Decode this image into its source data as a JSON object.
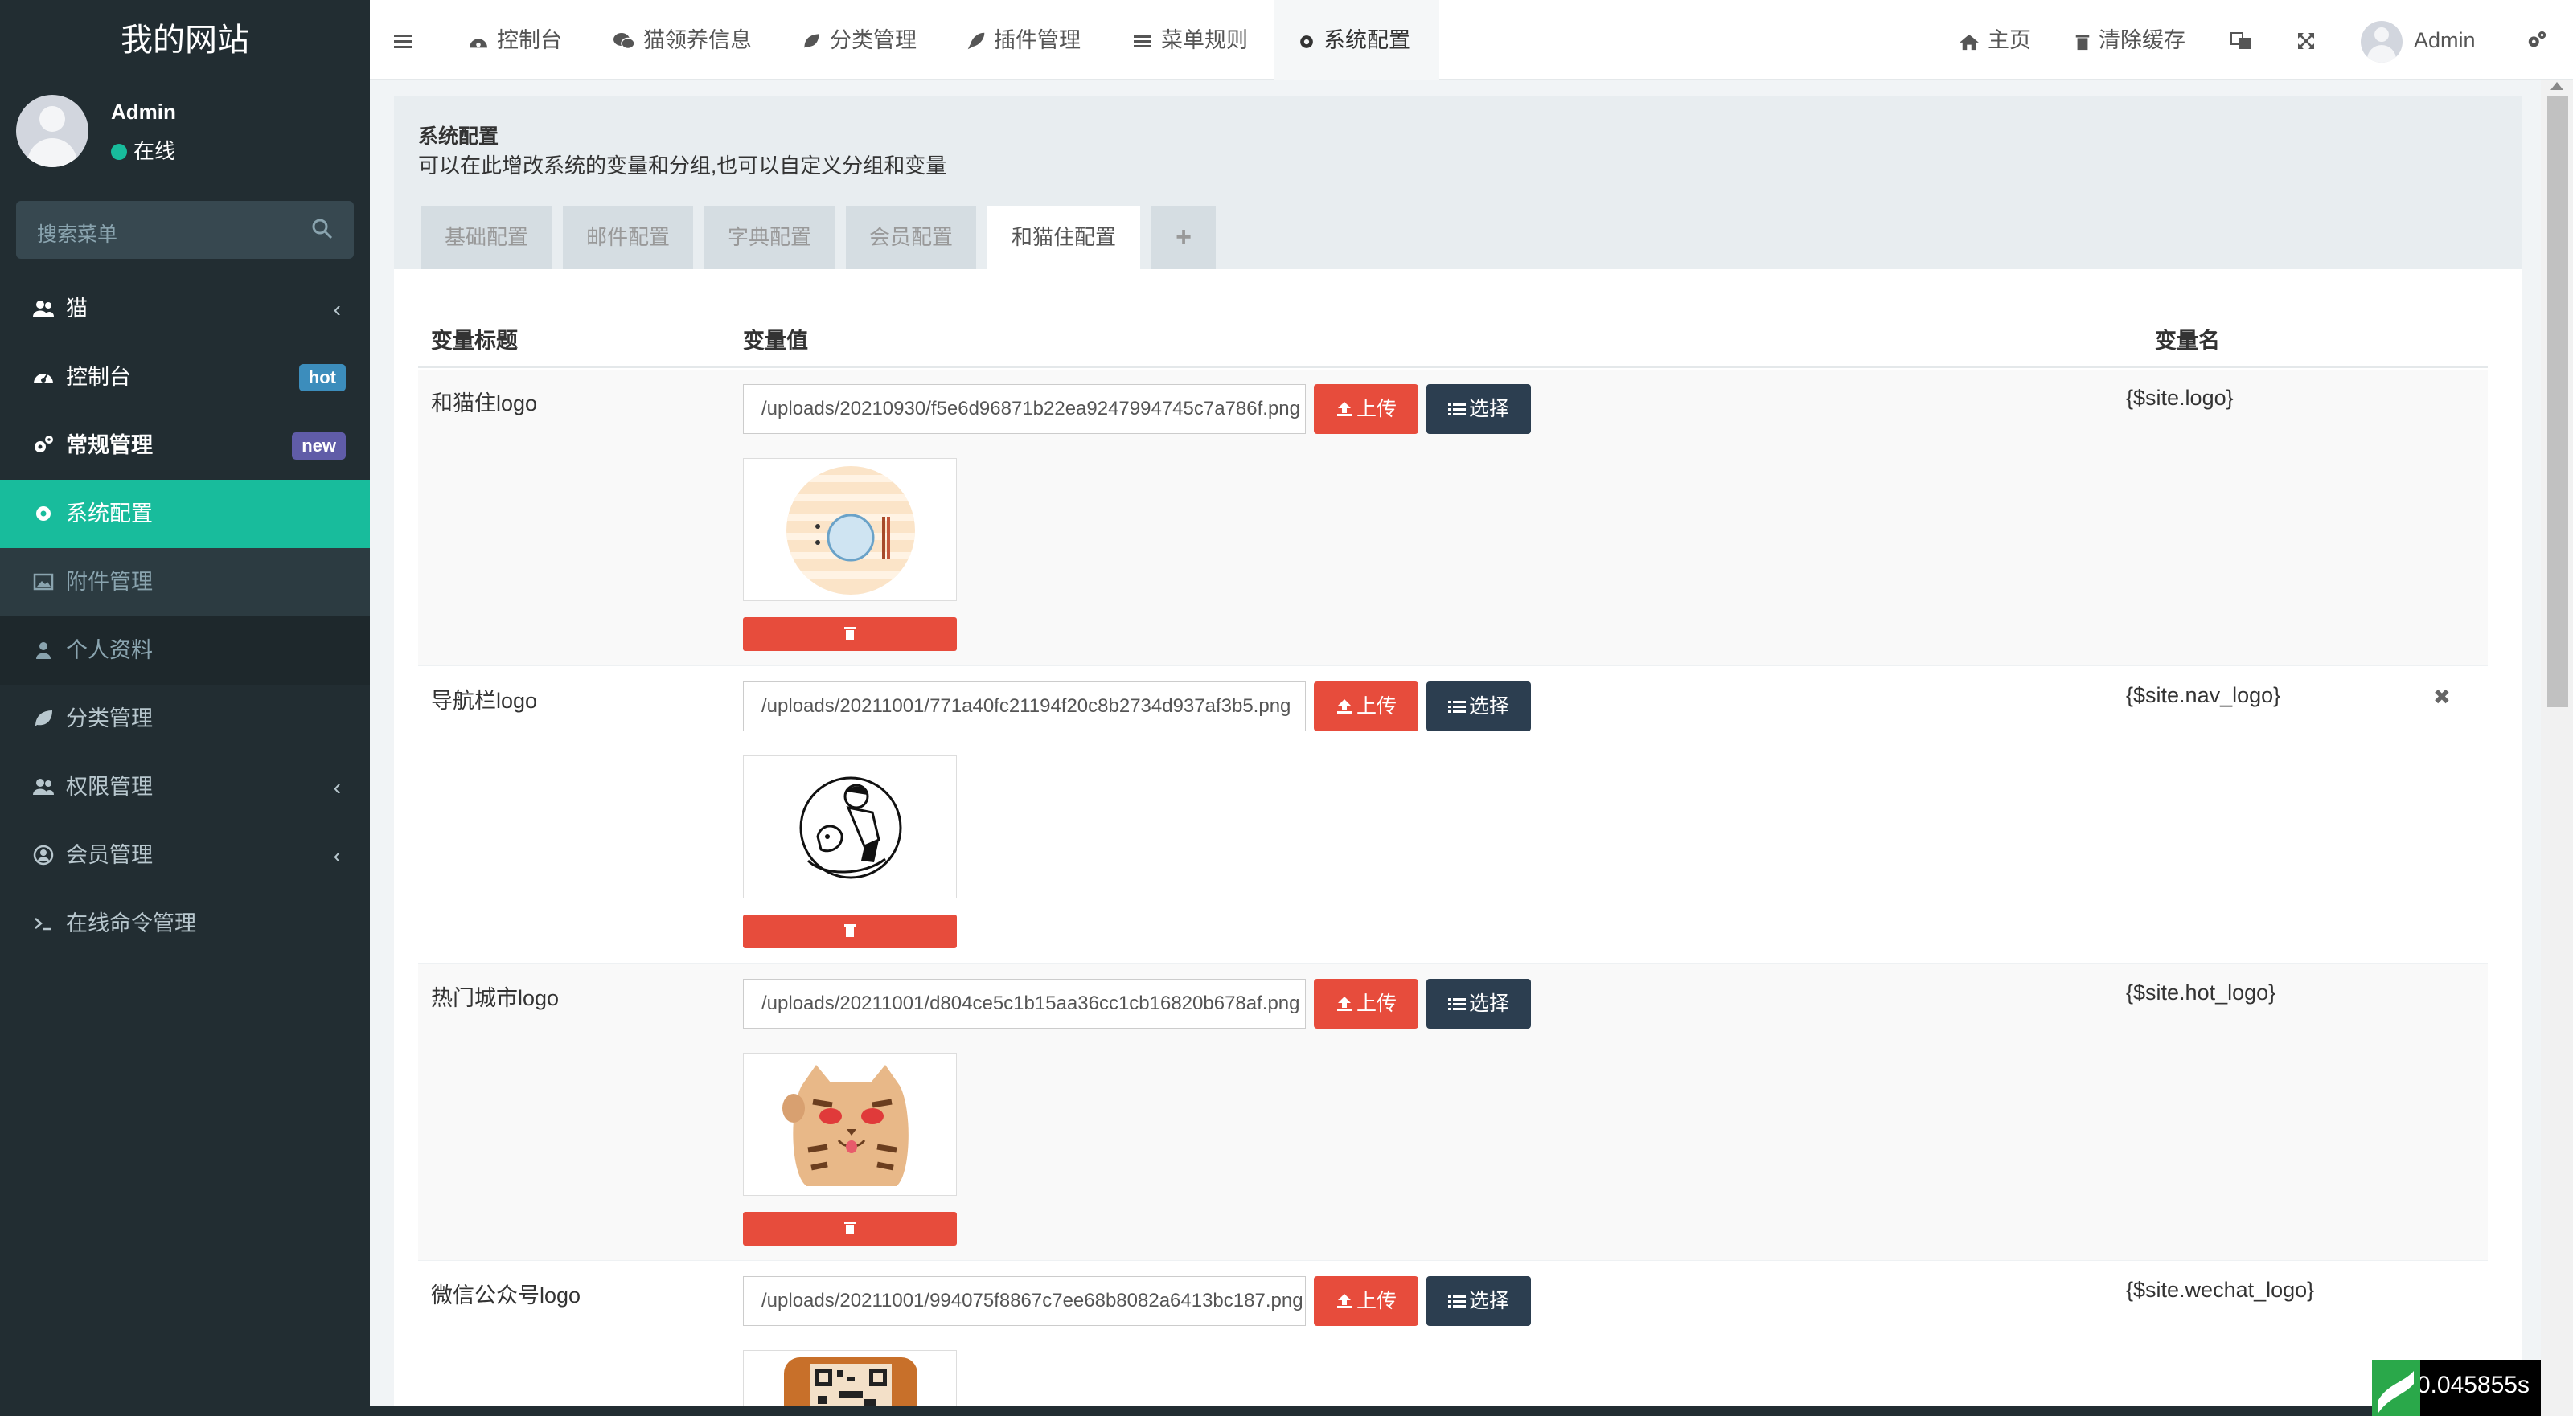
{
  "brand": "我的网站",
  "user": {
    "name": "Admin",
    "status": "在线"
  },
  "sidebar": {
    "search_placeholder": "搜索菜单",
    "items": [
      {
        "label": "猫",
        "icon": "users-icon"
      },
      {
        "label": "控制台",
        "icon": "dashboard-icon",
        "badge": "hot"
      },
      {
        "label": "常规管理",
        "icon": "cogs-icon",
        "badge": "new"
      },
      {
        "label": "系统配置",
        "icon": "gear-icon"
      },
      {
        "label": "附件管理",
        "icon": "image-icon"
      },
      {
        "label": "个人资料",
        "icon": "user-icon"
      },
      {
        "label": "分类管理",
        "icon": "leaf-icon"
      },
      {
        "label": "权限管理",
        "icon": "group-icon"
      },
      {
        "label": "会员管理",
        "icon": "user-circle-icon"
      },
      {
        "label": "在线命令管理",
        "icon": "terminal-icon"
      }
    ]
  },
  "topnav": {
    "tabs": [
      "控制台",
      "猫领养信息",
      "分类管理",
      "插件管理",
      "菜单规则",
      "系统配置"
    ],
    "right": {
      "home": "主页",
      "clear_cache": "清除缓存",
      "admin": "Admin"
    }
  },
  "panel": {
    "title": "系统配置",
    "desc": "可以在此增改系统的变量和分组,也可以自定义分组和变量",
    "tabs": [
      "基础配置",
      "邮件配置",
      "字典配置",
      "会员配置",
      "和猫住配置",
      "+"
    ]
  },
  "table": {
    "headers": [
      "变量标题",
      "变量值",
      "变量名"
    ],
    "upload_label": "上传",
    "select_label": "选择",
    "rows": [
      {
        "title": "和猫住logo",
        "value": "/uploads/20210930/f5e6d96871b22ea9247994745c7a786f.png",
        "name": "{$site.logo}"
      },
      {
        "title": "导航栏logo",
        "value": "/uploads/20211001/771a40fc21194f20c8b2734d937af3b5.png",
        "name": "{$site.nav_logo}"
      },
      {
        "title": "热门城市logo",
        "value": "/uploads/20211001/d804ce5c1b15aa36cc1cb16820b678af.png",
        "name": "{$site.hot_logo}"
      },
      {
        "title": "微信公众号logo",
        "value": "/uploads/20211001/994075f8867c7ee68b8082a6413bc187.png",
        "name": "{$site.wechat_logo}"
      }
    ]
  },
  "timer": "0.045855s",
  "colors": {
    "sidebar_bg": "#222d32",
    "active": "#18bc9c",
    "danger": "#e74c3c",
    "dark": "#2c3e50"
  }
}
